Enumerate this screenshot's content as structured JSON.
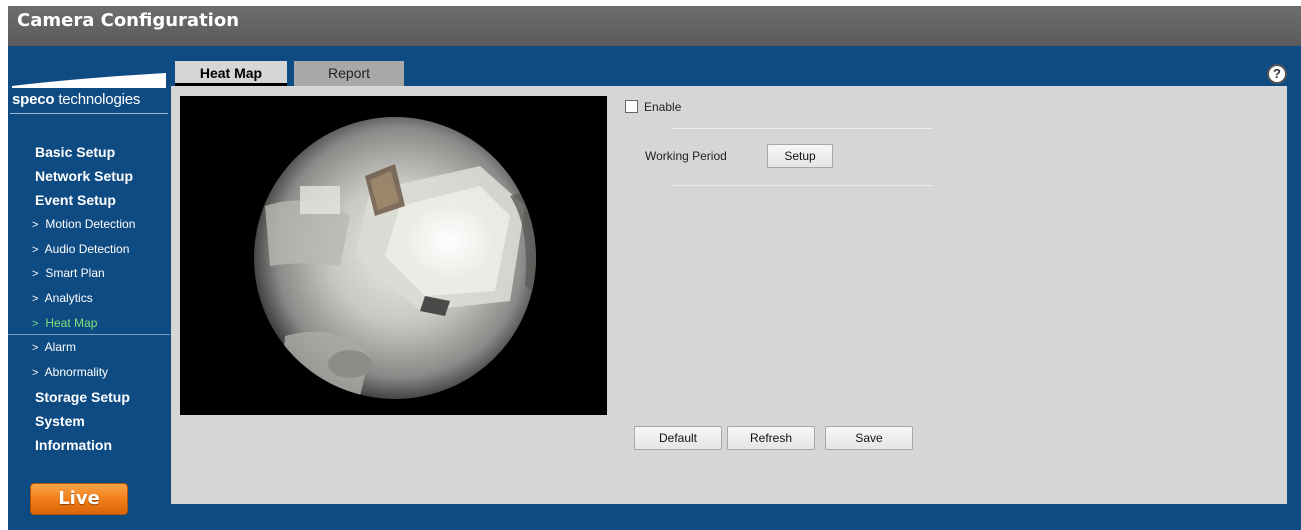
{
  "app": {
    "title": "Camera Configuration"
  },
  "brand": {
    "logo_bold": "speco",
    "logo_rest": " technologies"
  },
  "sidebar": {
    "items": [
      {
        "label": "Basic Setup",
        "type": "main"
      },
      {
        "label": "Network Setup",
        "type": "main"
      },
      {
        "label": "Event Setup",
        "type": "main"
      },
      {
        "label": "Motion Detection",
        "type": "sub"
      },
      {
        "label": "Audio Detection",
        "type": "sub"
      },
      {
        "label": "Smart Plan",
        "type": "sub"
      },
      {
        "label": "Analytics",
        "type": "sub"
      },
      {
        "label": "Heat Map",
        "type": "sub",
        "active": true
      },
      {
        "label": "Alarm",
        "type": "sub"
      },
      {
        "label": "Abnormality",
        "type": "sub"
      },
      {
        "label": "Storage Setup",
        "type": "main"
      },
      {
        "label": "System",
        "type": "main"
      },
      {
        "label": "Information",
        "type": "main"
      }
    ],
    "chevron": ">",
    "live_label": "Live"
  },
  "tabs": [
    {
      "label": "Heat Map",
      "active": true
    },
    {
      "label": "Report",
      "active": false
    }
  ],
  "help": {
    "icon": "help-icon",
    "glyph": "?"
  },
  "form": {
    "enable_label": "Enable",
    "enable_checked": false,
    "working_period_label": "Working Period",
    "setup_button": "Setup"
  },
  "actions": {
    "default": "Default",
    "refresh": "Refresh",
    "save": "Save"
  },
  "colors": {
    "frame_blue": "#0f4b83",
    "panel_gray": "#d6d6d6",
    "active_nav_green": "#7fe07a",
    "live_orange": "#f07c16"
  }
}
